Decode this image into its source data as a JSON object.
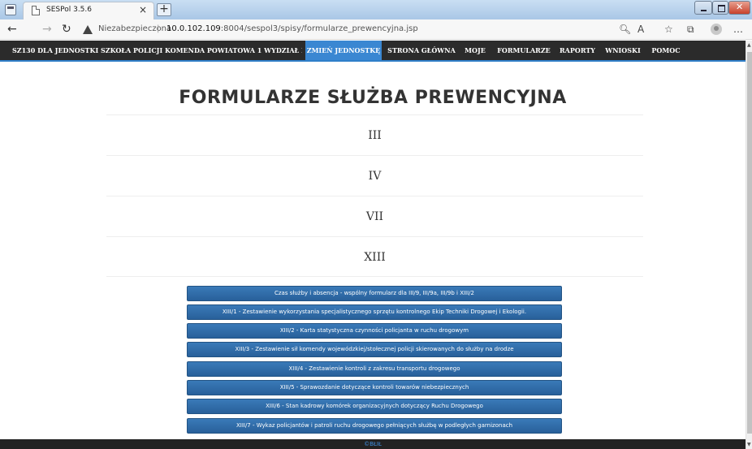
{
  "browser": {
    "tab_title": "SESPol 3.5.6",
    "tab_close": "×",
    "new_tab": "+",
    "security_warning": "Niezabezpieczona",
    "separator": "|",
    "url_host": "10.0.102.109",
    "url_path": ":8004/sespol3/spisy/formularze_prewencyjna.jsp"
  },
  "appnav": {
    "unit_label": "SZ130 DLA JEDNOSTKI SZKOŁA POLICJI KOMENDA POWIATOWA 1 WYDZIAŁ PREWENCJI",
    "items": [
      {
        "label": "ZMIEŃ JEDNOSTKĘ",
        "active": true
      },
      {
        "label": "STRONA GŁÓWNA"
      },
      {
        "label": "MOJE"
      },
      {
        "label": "FORMULARZE"
      },
      {
        "label": "RAPORTY"
      },
      {
        "label": "WNIOSKI"
      },
      {
        "label": "POMOC"
      }
    ],
    "accent_color": "#3a87d2",
    "bar_color": "#2b2b2b"
  },
  "main": {
    "title": "FORMULARZE SŁUŻBA PREWENCYJNA",
    "sections": [
      "III",
      "IV",
      "VII",
      "XIII"
    ],
    "form_buttons": [
      "Czas służby i absencja - wspólny formularz dla III/9, III/9a, III/9b i XIII/2",
      "XIII/1 - Zestawienie wykorzystania specjalistycznego sprzętu kontrolnego Ekip Techniki Drogowej i Ekologii.",
      "XIII/2 - Karta statystyczna czynności policjanta w ruchu drogowym",
      "XIII/3 - Zestawienie sił komendy wojewódzkiej/stołecznej policji skierowanych do służby na drodze",
      "XIII/4 - Zestawienie kontroli z zakresu transportu drogowego",
      "XIII/5 - Sprawozdanie dotyczące kontroli towarów niebezpiecznych",
      "XIII/6 - Stan kadrowy komórek organizacyjnych dotyczący Ruchu Drogowego",
      "XIII/7 - Wykaz policjantów i patroli ruchu drogowego pełniących służbę w podległych garnizonach"
    ],
    "button_color": "#2f6eab"
  },
  "footer": {
    "text": "©BŁIŁ"
  }
}
